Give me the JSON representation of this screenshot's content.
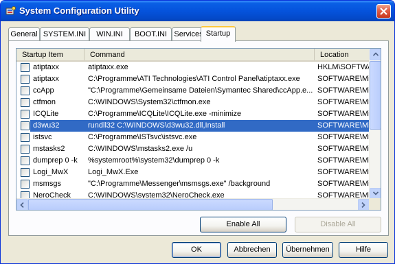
{
  "window": {
    "title": "System Configuration Utility",
    "close_icon": "close-icon",
    "app_icon": "msconfig-icon"
  },
  "tabs": [
    {
      "label": "General",
      "active": false
    },
    {
      "label": "SYSTEM.INI",
      "active": false
    },
    {
      "label": "WIN.INI",
      "active": false
    },
    {
      "label": "BOOT.INI",
      "active": false
    },
    {
      "label": "Services",
      "active": false
    },
    {
      "label": "Startup",
      "active": true
    }
  ],
  "startup": {
    "columns": {
      "item": "Startup Item",
      "command": "Command",
      "location": "Location"
    },
    "rows": [
      {
        "item": "atiptaxx",
        "command": "atiptaxx.exe",
        "location": "HKLM\\SOFTWA",
        "checked": false,
        "selected": false
      },
      {
        "item": "atiptaxx",
        "command": "C:\\Programme\\ATI Technologies\\ATI Control Panel\\atiptaxx.exe",
        "location": "SOFTWARE\\Mic",
        "checked": false,
        "selected": false
      },
      {
        "item": "ccApp",
        "command": "\"C:\\Programme\\Gemeinsame Dateien\\Symantec Shared\\ccApp.e...",
        "location": "SOFTWARE\\Mic",
        "checked": false,
        "selected": false
      },
      {
        "item": "ctfmon",
        "command": "C:\\WINDOWS\\System32\\ctfmon.exe",
        "location": "SOFTWARE\\Mic",
        "checked": false,
        "selected": false
      },
      {
        "item": "ICQLite",
        "command": "C:\\Programme\\ICQLite\\ICQLite.exe -minimize",
        "location": "SOFTWARE\\Mic",
        "checked": false,
        "selected": false
      },
      {
        "item": "d3wu32",
        "command": "rundll32 C:\\WINDOWS\\d3wu32.dll,Install",
        "location": "SOFTWARE\\Mic",
        "checked": false,
        "selected": true
      },
      {
        "item": "istsvc",
        "command": "C:\\Programme\\ISTsvc\\istsvc.exe",
        "location": "SOFTWARE\\Mic",
        "checked": false,
        "selected": false
      },
      {
        "item": "mstasks2",
        "command": "C:\\WINDOWS\\mstasks2.exe /u",
        "location": "SOFTWARE\\Mic",
        "checked": false,
        "selected": false
      },
      {
        "item": "dumprep 0 -k",
        "command": "%systemroot%\\system32\\dumprep 0 -k",
        "location": "SOFTWARE\\Mic",
        "checked": false,
        "selected": false
      },
      {
        "item": "Logi_MwX",
        "command": "Logi_MwX.Exe",
        "location": "SOFTWARE\\Mic",
        "checked": false,
        "selected": false
      },
      {
        "item": "msmsgs",
        "command": "\"C:\\Programme\\Messenger\\msmsgs.exe\" /background",
        "location": "SOFTWARE\\Mic",
        "checked": false,
        "selected": false
      },
      {
        "item": "NeroCheck",
        "command": "C:\\WINDOWS\\system32\\NeroCheck.exe",
        "location": "SOFTWARE\\Mic",
        "checked": false,
        "selected": false
      }
    ],
    "enable_all": "Enable All",
    "disable_all": "Disable All"
  },
  "footer": {
    "ok": "OK",
    "cancel": "Abbrechen",
    "apply": "Übernehmen",
    "help": "Hilfe"
  }
}
